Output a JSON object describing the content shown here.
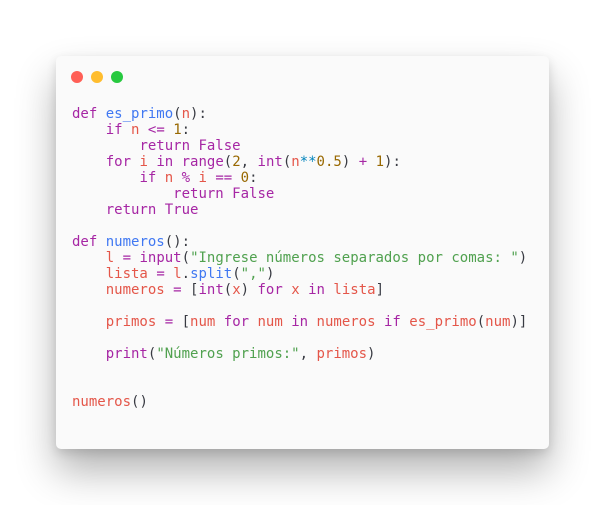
{
  "window": {
    "background": "#fafafa",
    "traffic_lights": [
      {
        "name": "close",
        "color": "#ff5f56"
      },
      {
        "name": "minimize",
        "color": "#ffbd2e"
      },
      {
        "name": "maximize",
        "color": "#27c93f"
      }
    ]
  },
  "palette": {
    "keyword": "#a626a4",
    "function": "#4078f2",
    "variable": "#e45649",
    "number": "#986801",
    "string": "#50a14f",
    "operator": "#0184bc",
    "plain": "#383a42"
  },
  "code": {
    "language": "python",
    "lines": [
      [
        {
          "t": "def",
          "k": "keyword"
        },
        {
          "t": " ",
          "k": "plain"
        },
        {
          "t": "es_primo",
          "k": "function"
        },
        {
          "t": "(",
          "k": "plain"
        },
        {
          "t": "n",
          "k": "variable"
        },
        {
          "t": "):",
          "k": "plain"
        }
      ],
      [
        {
          "t": "    ",
          "k": "plain"
        },
        {
          "t": "if",
          "k": "keyword"
        },
        {
          "t": " ",
          "k": "plain"
        },
        {
          "t": "n",
          "k": "variable"
        },
        {
          "t": " ",
          "k": "plain"
        },
        {
          "t": "<=",
          "k": "keyword"
        },
        {
          "t": " ",
          "k": "plain"
        },
        {
          "t": "1",
          "k": "number"
        },
        {
          "t": ":",
          "k": "plain"
        }
      ],
      [
        {
          "t": "        ",
          "k": "plain"
        },
        {
          "t": "return",
          "k": "keyword"
        },
        {
          "t": " ",
          "k": "plain"
        },
        {
          "t": "False",
          "k": "keyword"
        }
      ],
      [
        {
          "t": "    ",
          "k": "plain"
        },
        {
          "t": "for",
          "k": "keyword"
        },
        {
          "t": " ",
          "k": "plain"
        },
        {
          "t": "i",
          "k": "variable"
        },
        {
          "t": " ",
          "k": "plain"
        },
        {
          "t": "in",
          "k": "keyword"
        },
        {
          "t": " ",
          "k": "plain"
        },
        {
          "t": "range",
          "k": "keyword"
        },
        {
          "t": "(",
          "k": "plain"
        },
        {
          "t": "2",
          "k": "number"
        },
        {
          "t": ", ",
          "k": "plain"
        },
        {
          "t": "int",
          "k": "keyword"
        },
        {
          "t": "(",
          "k": "plain"
        },
        {
          "t": "n",
          "k": "variable"
        },
        {
          "t": "**",
          "k": "operator"
        },
        {
          "t": "0.5",
          "k": "number"
        },
        {
          "t": ") ",
          "k": "plain"
        },
        {
          "t": "+",
          "k": "keyword"
        },
        {
          "t": " ",
          "k": "plain"
        },
        {
          "t": "1",
          "k": "number"
        },
        {
          "t": "):",
          "k": "plain"
        }
      ],
      [
        {
          "t": "        ",
          "k": "plain"
        },
        {
          "t": "if",
          "k": "keyword"
        },
        {
          "t": " ",
          "k": "plain"
        },
        {
          "t": "n",
          "k": "variable"
        },
        {
          "t": " ",
          "k": "plain"
        },
        {
          "t": "%",
          "k": "keyword"
        },
        {
          "t": " ",
          "k": "plain"
        },
        {
          "t": "i",
          "k": "variable"
        },
        {
          "t": " ",
          "k": "plain"
        },
        {
          "t": "==",
          "k": "keyword"
        },
        {
          "t": " ",
          "k": "plain"
        },
        {
          "t": "0",
          "k": "number"
        },
        {
          "t": ":",
          "k": "plain"
        }
      ],
      [
        {
          "t": "            ",
          "k": "plain"
        },
        {
          "t": "return",
          "k": "keyword"
        },
        {
          "t": " ",
          "k": "plain"
        },
        {
          "t": "False",
          "k": "keyword"
        }
      ],
      [
        {
          "t": "    ",
          "k": "plain"
        },
        {
          "t": "return",
          "k": "keyword"
        },
        {
          "t": " ",
          "k": "plain"
        },
        {
          "t": "True",
          "k": "keyword"
        }
      ],
      [],
      [
        {
          "t": "def",
          "k": "keyword"
        },
        {
          "t": " ",
          "k": "plain"
        },
        {
          "t": "numeros",
          "k": "function"
        },
        {
          "t": "():",
          "k": "plain"
        }
      ],
      [
        {
          "t": "    ",
          "k": "plain"
        },
        {
          "t": "l",
          "k": "variable"
        },
        {
          "t": " ",
          "k": "plain"
        },
        {
          "t": "=",
          "k": "keyword"
        },
        {
          "t": " ",
          "k": "plain"
        },
        {
          "t": "input",
          "k": "keyword"
        },
        {
          "t": "(",
          "k": "plain"
        },
        {
          "t": "\"Ingrese números separados por comas: \"",
          "k": "string"
        },
        {
          "t": ")",
          "k": "plain"
        }
      ],
      [
        {
          "t": "    ",
          "k": "plain"
        },
        {
          "t": "lista",
          "k": "variable"
        },
        {
          "t": " ",
          "k": "plain"
        },
        {
          "t": "=",
          "k": "keyword"
        },
        {
          "t": " ",
          "k": "plain"
        },
        {
          "t": "l",
          "k": "variable"
        },
        {
          "t": ".",
          "k": "plain"
        },
        {
          "t": "split",
          "k": "function"
        },
        {
          "t": "(",
          "k": "plain"
        },
        {
          "t": "\",\"",
          "k": "string"
        },
        {
          "t": ")",
          "k": "plain"
        }
      ],
      [
        {
          "t": "    ",
          "k": "plain"
        },
        {
          "t": "numeros",
          "k": "variable"
        },
        {
          "t": " ",
          "k": "plain"
        },
        {
          "t": "=",
          "k": "keyword"
        },
        {
          "t": " [",
          "k": "plain"
        },
        {
          "t": "int",
          "k": "keyword"
        },
        {
          "t": "(",
          "k": "plain"
        },
        {
          "t": "x",
          "k": "variable"
        },
        {
          "t": ") ",
          "k": "plain"
        },
        {
          "t": "for",
          "k": "keyword"
        },
        {
          "t": " ",
          "k": "plain"
        },
        {
          "t": "x",
          "k": "variable"
        },
        {
          "t": " ",
          "k": "plain"
        },
        {
          "t": "in",
          "k": "keyword"
        },
        {
          "t": " ",
          "k": "plain"
        },
        {
          "t": "lista",
          "k": "variable"
        },
        {
          "t": "]",
          "k": "plain"
        }
      ],
      [],
      [
        {
          "t": "    ",
          "k": "plain"
        },
        {
          "t": "primos",
          "k": "variable"
        },
        {
          "t": " ",
          "k": "plain"
        },
        {
          "t": "=",
          "k": "keyword"
        },
        {
          "t": " [",
          "k": "plain"
        },
        {
          "t": "num",
          "k": "variable"
        },
        {
          "t": " ",
          "k": "plain"
        },
        {
          "t": "for",
          "k": "keyword"
        },
        {
          "t": " ",
          "k": "plain"
        },
        {
          "t": "num",
          "k": "variable"
        },
        {
          "t": " ",
          "k": "plain"
        },
        {
          "t": "in",
          "k": "keyword"
        },
        {
          "t": " ",
          "k": "plain"
        },
        {
          "t": "numeros",
          "k": "variable"
        },
        {
          "t": " ",
          "k": "plain"
        },
        {
          "t": "if",
          "k": "keyword"
        },
        {
          "t": " ",
          "k": "plain"
        },
        {
          "t": "es_primo",
          "k": "variable"
        },
        {
          "t": "(",
          "k": "plain"
        },
        {
          "t": "num",
          "k": "variable"
        },
        {
          "t": ")]",
          "k": "plain"
        }
      ],
      [],
      [
        {
          "t": "    ",
          "k": "plain"
        },
        {
          "t": "print",
          "k": "keyword"
        },
        {
          "t": "(",
          "k": "plain"
        },
        {
          "t": "\"Números primos:\"",
          "k": "string"
        },
        {
          "t": ", ",
          "k": "plain"
        },
        {
          "t": "primos",
          "k": "variable"
        },
        {
          "t": ")",
          "k": "plain"
        }
      ],
      [],
      [],
      [
        {
          "t": "numeros",
          "k": "variable"
        },
        {
          "t": "()",
          "k": "plain"
        }
      ]
    ]
  }
}
